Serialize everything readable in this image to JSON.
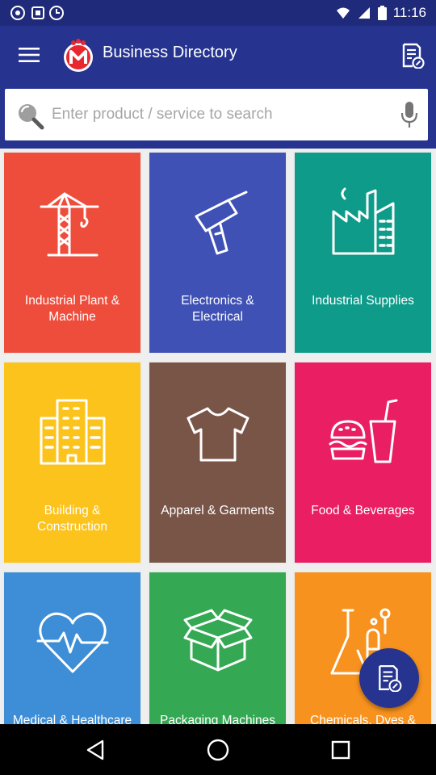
{
  "status_bar": {
    "time": "11:16"
  },
  "app_bar": {
    "title": "Business Directory"
  },
  "search": {
    "placeholder": "Enter product / service to search",
    "value": ""
  },
  "categories": [
    {
      "label": "Industrial Plant & Machine",
      "icon": "crane-icon",
      "color": "#ee4d3c"
    },
    {
      "label": "Electronics & Electrical",
      "icon": "drill-icon",
      "color": "#3f51b5"
    },
    {
      "label": "Industrial Supplies",
      "icon": "factory-icon",
      "color": "#0e9b8a"
    },
    {
      "label": "Building & Construction",
      "icon": "building-icon",
      "color": "#fbc31c"
    },
    {
      "label": "Apparel & Garments",
      "icon": "tshirt-icon",
      "color": "#795548"
    },
    {
      "label": "Food & Beverages",
      "icon": "burger-drink-icon",
      "color": "#e91e63"
    },
    {
      "label": "Medical & Healthcare",
      "icon": "heartbeat-icon",
      "color": "#3d8ed6"
    },
    {
      "label": "Packaging Machines",
      "icon": "box-icon",
      "color": "#34a853"
    },
    {
      "label": "Chemicals, Dyes & Solvents",
      "icon": "flask-icon",
      "color": "#f7921e"
    }
  ],
  "colors": {
    "app_bar": "#26338f",
    "status_bar": "#1f2b7a",
    "fab": "#26338f"
  }
}
